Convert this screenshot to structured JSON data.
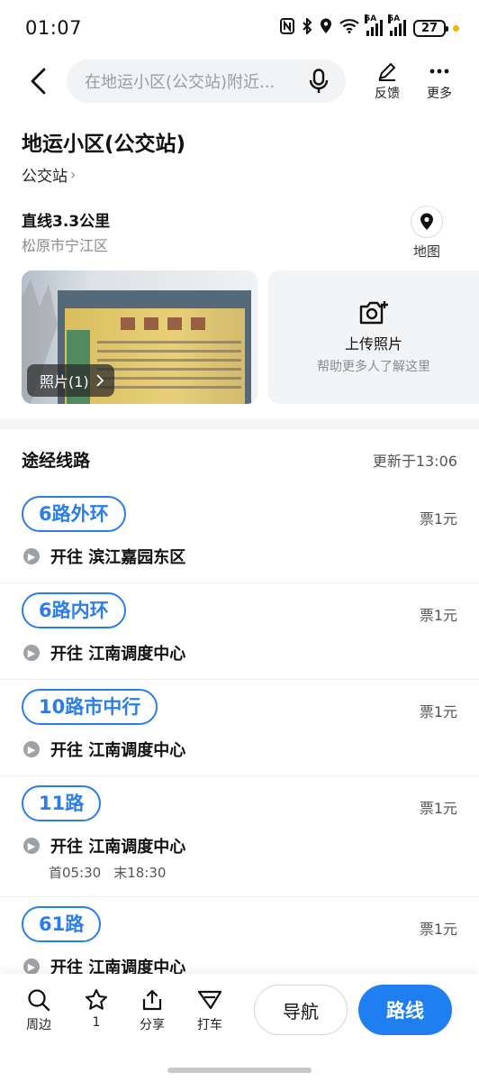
{
  "status_bar": {
    "time": "01:07",
    "battery": "27",
    "signal_labels": [
      "5A",
      "5A"
    ]
  },
  "header": {
    "search_placeholder": "在地运小区(公交站)附近...",
    "feedback_label": "反馈",
    "more_label": "更多"
  },
  "poi": {
    "title": "地运小区(公交站)",
    "category": "公交站",
    "distance": "直线3.3公里",
    "district": "松原市宁江区",
    "map_label": "地图"
  },
  "photos": {
    "badge_label": "照片(1)",
    "upload_title": "上传照片",
    "upload_subtitle": "帮助更多人了解这里"
  },
  "routes": {
    "section_title": "途经线路",
    "updated": "更新于13:06",
    "items": [
      {
        "name": "6路外环",
        "fare": "票1元",
        "direction": "开往 滨江嘉园东区"
      },
      {
        "name": "6路内环",
        "fare": "票1元",
        "direction": "开往 江南调度中心"
      },
      {
        "name": "10路市中行",
        "fare": "票1元",
        "direction": "开往 江南调度中心"
      },
      {
        "name": "11路",
        "fare": "票1元",
        "direction": "开往 江南调度中心",
        "first": "首05:30",
        "last": "末18:30"
      },
      {
        "name": "61路",
        "fare": "票1元",
        "direction": "开往 江南调度中心"
      }
    ]
  },
  "bottom_bar": {
    "nearby": "周边",
    "favorites_count": "1",
    "share": "分享",
    "taxi": "打车",
    "navigate": "导航",
    "route": "路线"
  },
  "colors": {
    "accent": "#1f7ff0",
    "route_blue": "#2b7de9"
  }
}
